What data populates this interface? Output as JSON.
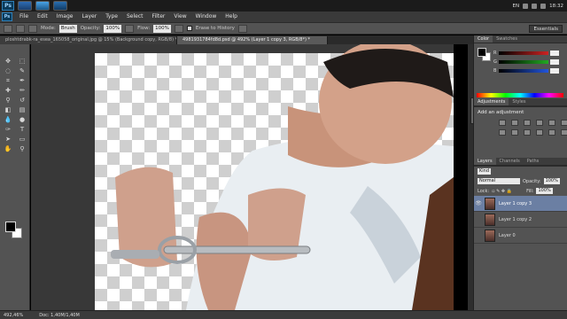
{
  "taskbar": {
    "app_logo": "Ps",
    "language": "EN",
    "time": "18:32"
  },
  "menubar": {
    "logo": "Ps",
    "items": [
      "File",
      "Edit",
      "Image",
      "Layer",
      "Type",
      "Select",
      "Filter",
      "View",
      "Window",
      "Help"
    ]
  },
  "options": {
    "mode_label": "Mode:",
    "mode_value": "Brush",
    "opacity_label": "Opacity:",
    "opacity_value": "100%",
    "flow_label": "Flow:",
    "flow_value": "100%",
    "erase_history_label": "Erase to History",
    "workspace": "Essentials"
  },
  "tabs": [
    {
      "label": "ploshtdrabk-ra_esea_165058_original.jpg @ 15% (Background copy, RGB/8) *",
      "active": false
    },
    {
      "label": "4981931784fd8d.psd @ 492% (Layer 1 copy 3, RGB/8*) *",
      "active": true
    }
  ],
  "status": {
    "zoom": "492,46%",
    "doc": "Doc: 1,40M/1,40M"
  },
  "panels": {
    "color_tabs": [
      "Color",
      "Swatches"
    ],
    "color_sliders": [
      {
        "label": "R",
        "color": "#cc2222"
      },
      {
        "label": "G",
        "color": "#22aa22"
      },
      {
        "label": "B",
        "color": "#2255dd"
      }
    ],
    "adj_tabs": [
      "Adjustments",
      "Styles"
    ],
    "adj_title": "Add an adjustment",
    "layers_tabs": [
      "Layers",
      "Channels",
      "Paths"
    ],
    "kind_label": "Kind",
    "blend_mode": "Normal",
    "opacity_label": "Opacity:",
    "opacity_value": "100%",
    "lock_label": "Lock:",
    "fill_label": "Fill:",
    "fill_value": "100%",
    "layers": [
      {
        "name": "Layer 1 copy 3",
        "active": true
      },
      {
        "name": "Layer 1 copy 2",
        "active": false
      },
      {
        "name": "Layer 0",
        "active": false
      }
    ]
  }
}
